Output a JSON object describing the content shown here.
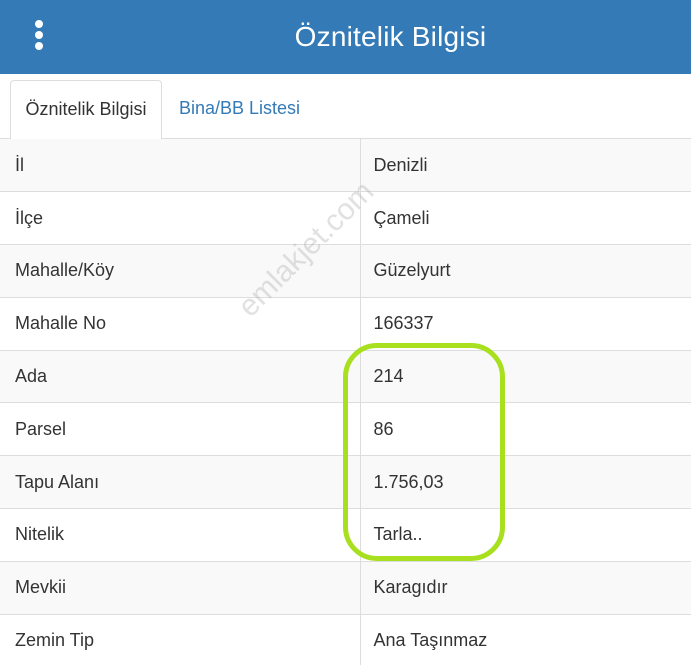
{
  "header": {
    "title": "Öznitelik Bilgisi",
    "menu_icon": "kebab-vertical-icon"
  },
  "tabs": [
    {
      "label": "Öznitelik Bilgisi",
      "active": true
    },
    {
      "label": "Bina/BB Listesi",
      "active": false
    }
  ],
  "attributes": [
    {
      "key": "İl",
      "value": "Denizli"
    },
    {
      "key": "İlçe",
      "value": "Çameli"
    },
    {
      "key": "Mahalle/Köy",
      "value": "Güzelyurt"
    },
    {
      "key": "Mahalle No",
      "value": "166337"
    },
    {
      "key": "Ada",
      "value": "214"
    },
    {
      "key": "Parsel",
      "value": "86"
    },
    {
      "key": "Tapu Alanı",
      "value": "1.756,03"
    },
    {
      "key": "Nitelik",
      "value": "Tarla.."
    },
    {
      "key": "Mevkii",
      "value": "Karagıdır"
    },
    {
      "key": "Zemin Tip",
      "value": "Ana Taşınmaz"
    }
  ],
  "watermark": "emlakjet.com",
  "colors": {
    "header_bg": "#337ab7",
    "link": "#337ab7",
    "highlight": "#a8e01f"
  }
}
